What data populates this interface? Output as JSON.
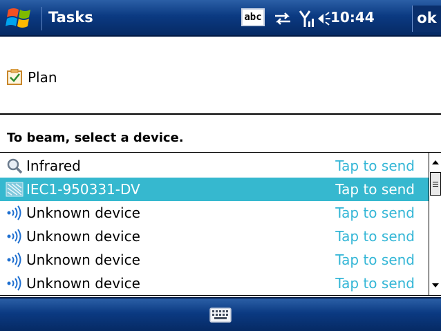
{
  "titlebar": {
    "app_title": "Tasks",
    "input_mode_label": "abc",
    "clock": "10:44",
    "ok_label": "ok"
  },
  "plan": {
    "label": "Plan"
  },
  "instruction": "To beam, select a device.",
  "devices": [
    {
      "name": "Infrared",
      "action": "Tap to send",
      "icon": "search-icon",
      "selected": false
    },
    {
      "name": "IEC1-950331-DV",
      "action": "Tap to send",
      "icon": "device-icon",
      "selected": true
    },
    {
      "name": "Unknown device",
      "action": "Tap to send",
      "icon": "bluetooth-signal-icon",
      "selected": false
    },
    {
      "name": "Unknown device",
      "action": "Tap to send",
      "icon": "bluetooth-signal-icon",
      "selected": false
    },
    {
      "name": "Unknown device",
      "action": "Tap to send",
      "icon": "bluetooth-signal-icon",
      "selected": false
    },
    {
      "name": "Unknown device",
      "action": "Tap to send",
      "icon": "bluetooth-signal-icon",
      "selected": false
    }
  ],
  "colors": {
    "titlebar": "#0b3a82",
    "selection": "#36b8cf",
    "action_text": "#33b6d6"
  }
}
